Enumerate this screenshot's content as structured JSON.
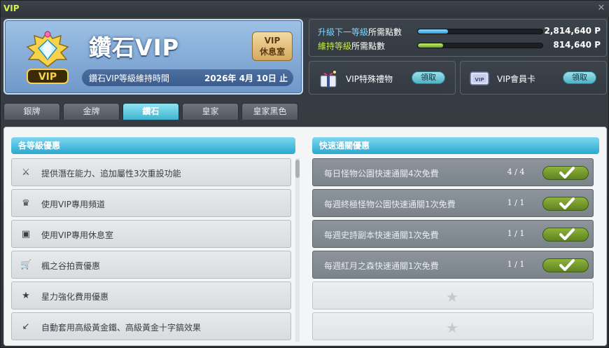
{
  "window": {
    "title": "VIP"
  },
  "banner": {
    "tier_name": "鑽石VIP",
    "lounge_line1": "VIP",
    "lounge_line2": "休息室",
    "maintain_label": "鑽石VIP等級維持時間",
    "maintain_date": "2026年 4月 10日 止",
    "badge_text": "VIP"
  },
  "points": {
    "upgrade": {
      "label_hl": "升級下一等級",
      "label_rest": "所需點數",
      "value": "2,814,640 P",
      "progress": 0.24
    },
    "maintain": {
      "label_hl": "維持等級",
      "label_rest": "所需點數",
      "value": "814,640 P",
      "progress": 0.2
    }
  },
  "rewards": {
    "gift": {
      "label": "VIP特殊禮物",
      "button": "領取",
      "icon": "gift-icon"
    },
    "card": {
      "label": "VIP會員卡",
      "button": "領取",
      "icon": "vip-card-icon",
      "card_text": "VIP"
    }
  },
  "tabs": [
    {
      "label": "銀牌"
    },
    {
      "label": "金牌"
    },
    {
      "label": "鑽石"
    },
    {
      "label": "皇家"
    },
    {
      "label": "皇家黑色"
    }
  ],
  "active_tab": 2,
  "left_section": {
    "title": "各等級優惠",
    "items": [
      {
        "icon": "potential-icon",
        "glyph": "⚔",
        "text": "提供潛在能力、追加屬性3次重設功能"
      },
      {
        "icon": "crown-icon",
        "glyph": "♛",
        "text": "使用VIP專用頻道"
      },
      {
        "icon": "lounge-icon",
        "glyph": "▣",
        "text": "使用VIP專用休息室"
      },
      {
        "icon": "cart-icon",
        "glyph": "🛒",
        "text": "楓之谷拍賣優惠"
      },
      {
        "icon": "star-icon",
        "glyph": "★",
        "text": "星力強化費用優惠"
      },
      {
        "icon": "hammer-icon",
        "glyph": "↙",
        "text": "自動套用高級黃金鐵、高級黃金十字鎬效果"
      }
    ]
  },
  "right_section": {
    "title": "快速通關優惠",
    "items": [
      {
        "text": "每日怪物公園快速通關4次免費",
        "count": "4 / 4",
        "done": true
      },
      {
        "text": "每週終極怪物公園快速通關1次免費",
        "count": "1 / 1",
        "done": true
      },
      {
        "text": "每週史詩副本快速通關1次免費",
        "count": "1 / 1",
        "done": true
      },
      {
        "text": "每週紅月之森快速通關1次免費",
        "count": "1 / 1",
        "done": true
      }
    ],
    "empty_slots": 2
  },
  "colors": {
    "accent": "#3fb4cf",
    "tier_title": "#ffffff",
    "done_green": "#6e9428",
    "upgrade_label": "#7fd3ff",
    "maintain_label": "#c5e84a"
  }
}
